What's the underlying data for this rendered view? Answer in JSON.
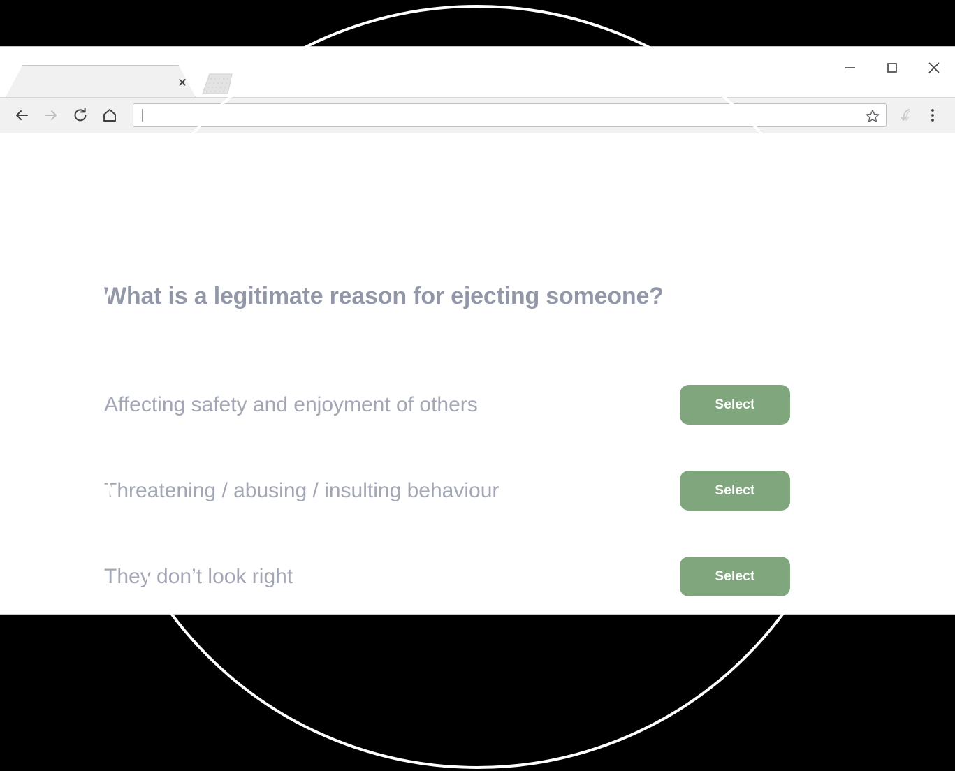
{
  "browser": {
    "tab": {
      "title": "",
      "close_icon": "close-icon",
      "new_tab_icon": "new-tab-icon"
    },
    "window_controls": [
      {
        "name": "minimize",
        "icon": "minimize-icon"
      },
      {
        "name": "maximize",
        "icon": "maximize-icon"
      },
      {
        "name": "close",
        "icon": "close-window-icon"
      }
    ],
    "toolbar": {
      "back_icon": "back-arrow-icon",
      "forward_icon": "forward-arrow-icon",
      "reload_icon": "reload-icon",
      "home_icon": "home-icon",
      "bookmark_icon": "star-icon",
      "profile_icon": "profile-icon",
      "menu_icon": "three-dot-menu-icon",
      "url_value": "",
      "url_placeholder": ""
    }
  },
  "page": {
    "heading": "What is a legitimate reason for ejecting someone?",
    "options": [
      {
        "label": "Affecting safety and enjoyment of others",
        "button": "Select"
      },
      {
        "label": "Threatening / abusing / insulting behaviour",
        "button": "Select"
      },
      {
        "label": "They don’t look right",
        "button": "Select"
      }
    ]
  },
  "colors": {
    "heading_text": "#9297a8",
    "option_text": "#a2a6b5",
    "button_green": "#7fa67c",
    "button_text": "#ffffff",
    "page_background": "#ffffff",
    "outer_background": "#000000",
    "overlay_stroke": "#ffffff"
  }
}
